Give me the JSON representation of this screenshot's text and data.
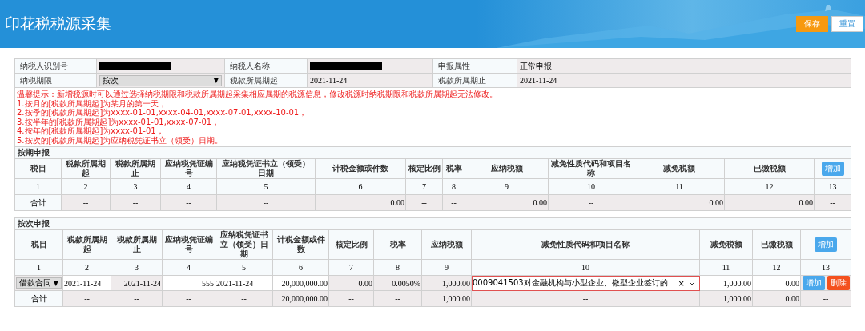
{
  "header": {
    "title": "印花税税源采集",
    "buttons": [
      {
        "label": "保存",
        "kind": "primary"
      },
      {
        "label": "重置",
        "kind": "secondary"
      }
    ]
  },
  "info": {
    "fields": [
      {
        "label": "纳税人识别号",
        "kind": "redacted",
        "redacted": true
      },
      {
        "label": "纳税人名称",
        "kind": "redacted",
        "redacted": true
      },
      {
        "label": "申报属性",
        "kind": "text",
        "value": "正常申报"
      },
      {
        "label": "纳税期限",
        "kind": "select",
        "value": "按次",
        "caret": "▼"
      },
      {
        "label": "税款所属期起",
        "kind": "text",
        "value": "2021-11-24"
      },
      {
        "label": "税款所属期止",
        "kind": "text",
        "value": "2021-11-24"
      }
    ],
    "notice": [
      "温馨提示：新增税源时可以通过选择纳税期限和税款所属期起采集相应属期的税源信息，修改税源时纳税期限和税款所属期起无法修改。",
      "1.按月的[税款所属期起]为某月的第一天，",
      "2.按季的[税款所属期起]为xxxx-01-01,xxxx-04-01,xxxx-07-01,xxxx-10-01，",
      "3.按半年的[税款所属期起]为xxxx-01-01,xxxx-07-01，",
      "4.按年的[税款所属期起]为xxxx-01-01，",
      "5.按次的[税款所属期起]为应纳税凭证书立（领受）日期。"
    ]
  },
  "sections": [
    {
      "title": "按期申报",
      "headers": [
        "税目",
        "税款所属期起",
        "税款所属期止",
        "应纳税凭证编号",
        "应纳税凭证书立（领受）日期",
        "计税金额或件数",
        "核定比例",
        "税率",
        "应纳税额",
        "减免性质代码和项目名称",
        "减免税额",
        "已缴税额"
      ],
      "add_button": "增加",
      "numbers": [
        "1",
        "2",
        "3",
        "4",
        "5",
        "6",
        "7",
        "8",
        "9",
        "10",
        "11",
        "12",
        "13"
      ],
      "totals": [
        "合计",
        "--",
        "--",
        "--",
        "--",
        "0.00",
        "--",
        "--",
        "0.00",
        "--",
        "0.00",
        "0.00",
        "--"
      ]
    },
    {
      "title": "按次申报",
      "headers": [
        "税目",
        "税款所属期起",
        "税款所属期止",
        "应纳税凭证编号",
        "应纳税凭证书立（领受）日期",
        "计税金额或件数",
        "核定比例",
        "税率",
        "应纳税额",
        "减免性质代码和项目名称",
        "减免税额",
        "已缴税额"
      ],
      "add_button": "增加",
      "numbers": [
        "1",
        "2",
        "3",
        "4",
        "5",
        "6",
        "7",
        "8",
        "9",
        "10",
        "11",
        "12",
        "13"
      ],
      "rows": [
        {
          "cells": [
            {
              "kind": "select",
              "value": "借款合同",
              "caret": "▼"
            },
            {
              "kind": "input",
              "value": "2021-11-24"
            },
            {
              "kind": "readonly",
              "value": "2021-11-24"
            },
            {
              "kind": "input",
              "value": "555"
            },
            {
              "kind": "input",
              "value": "2021-11-24"
            },
            {
              "kind": "input",
              "value": "20,000,000.00"
            },
            {
              "kind": "readonly",
              "value": "0.00"
            },
            {
              "kind": "readonly",
              "value": "0.0050%"
            },
            {
              "kind": "readonly",
              "value": "1,000.00"
            },
            {
              "kind": "combo",
              "value": "0009041503对金融机构与小型企业、微型企业签订的",
              "clear": "×",
              "highlighted": true
            },
            {
              "kind": "input",
              "value": "1,000.00"
            },
            {
              "kind": "input",
              "value": "0.00"
            },
            {
              "kind": "actions",
              "buttons": [
                {
                  "label": "增加",
                  "kind": "add"
                },
                {
                  "label": "删除",
                  "kind": "delete"
                }
              ]
            }
          ]
        }
      ],
      "totals": [
        "合计",
        "--",
        "--",
        "--",
        "--",
        "20,000,000.00",
        "--",
        "--",
        "1,000.00",
        "--",
        "1,000.00",
        "0.00",
        "--"
      ]
    }
  ]
}
